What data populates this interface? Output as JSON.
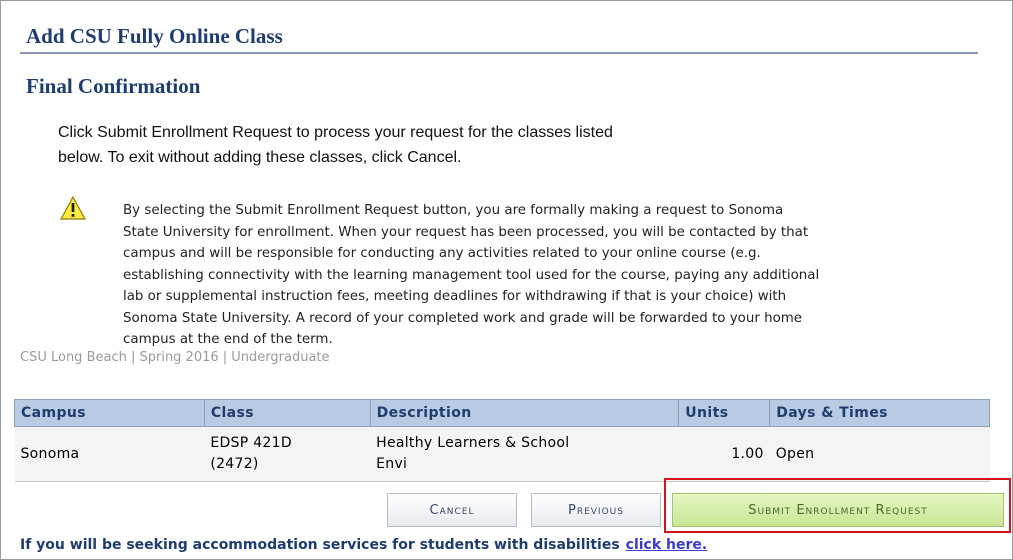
{
  "page_title": "Add CSU Fully Online Class",
  "section_title": "Final Confirmation",
  "intro_line1": "Click Submit Enrollment Request to process your request for the classes listed",
  "intro_line2": "below. To exit without adding these classes, click Cancel.",
  "warning": {
    "icon": "warning-triangle-icon",
    "lines": [
      "By selecting the Submit Enrollment Request button, you are formally making a request to Sonoma",
      "State University for enrollment. When your request has been processed,  you will be contacted by that",
      "campus and will be responsible for conducting any activities related to your online course (e.g.",
      "establishing connectivity with the learning management tool used for the course, paying any additional",
      "lab or supplemental instruction fees, meeting deadlines for withdrawing if that is your choice) with",
      "Sonoma State University.  A record of your completed work and grade will be forwarded to your home",
      "campus at the end of the term."
    ]
  },
  "term_line": "CSU Long Beach | Spring 2016 | Undergraduate",
  "table": {
    "headers": [
      "Campus",
      "Class",
      "Description",
      "Units",
      "Days & Times"
    ],
    "row": {
      "campus": "Sonoma",
      "class_line1": "EDSP 421D",
      "class_line2": "(2472)",
      "desc_line1": "Healthy Learners & School",
      "desc_line2": "Envi",
      "units": "1.00",
      "days_times": "Open"
    }
  },
  "buttons": {
    "cancel": "Cancel",
    "previous": "Previous",
    "submit": "Submit Enrollment Request"
  },
  "accommodation_text": "If you will be seeking accommodation services for students with disabilities",
  "accommodation_link": "click here.",
  "colors": {
    "heading": "#1f3c6e",
    "table_header": "#b9cbe3",
    "submit_button": "#c8e692",
    "highlight_box": "#d4141c"
  }
}
